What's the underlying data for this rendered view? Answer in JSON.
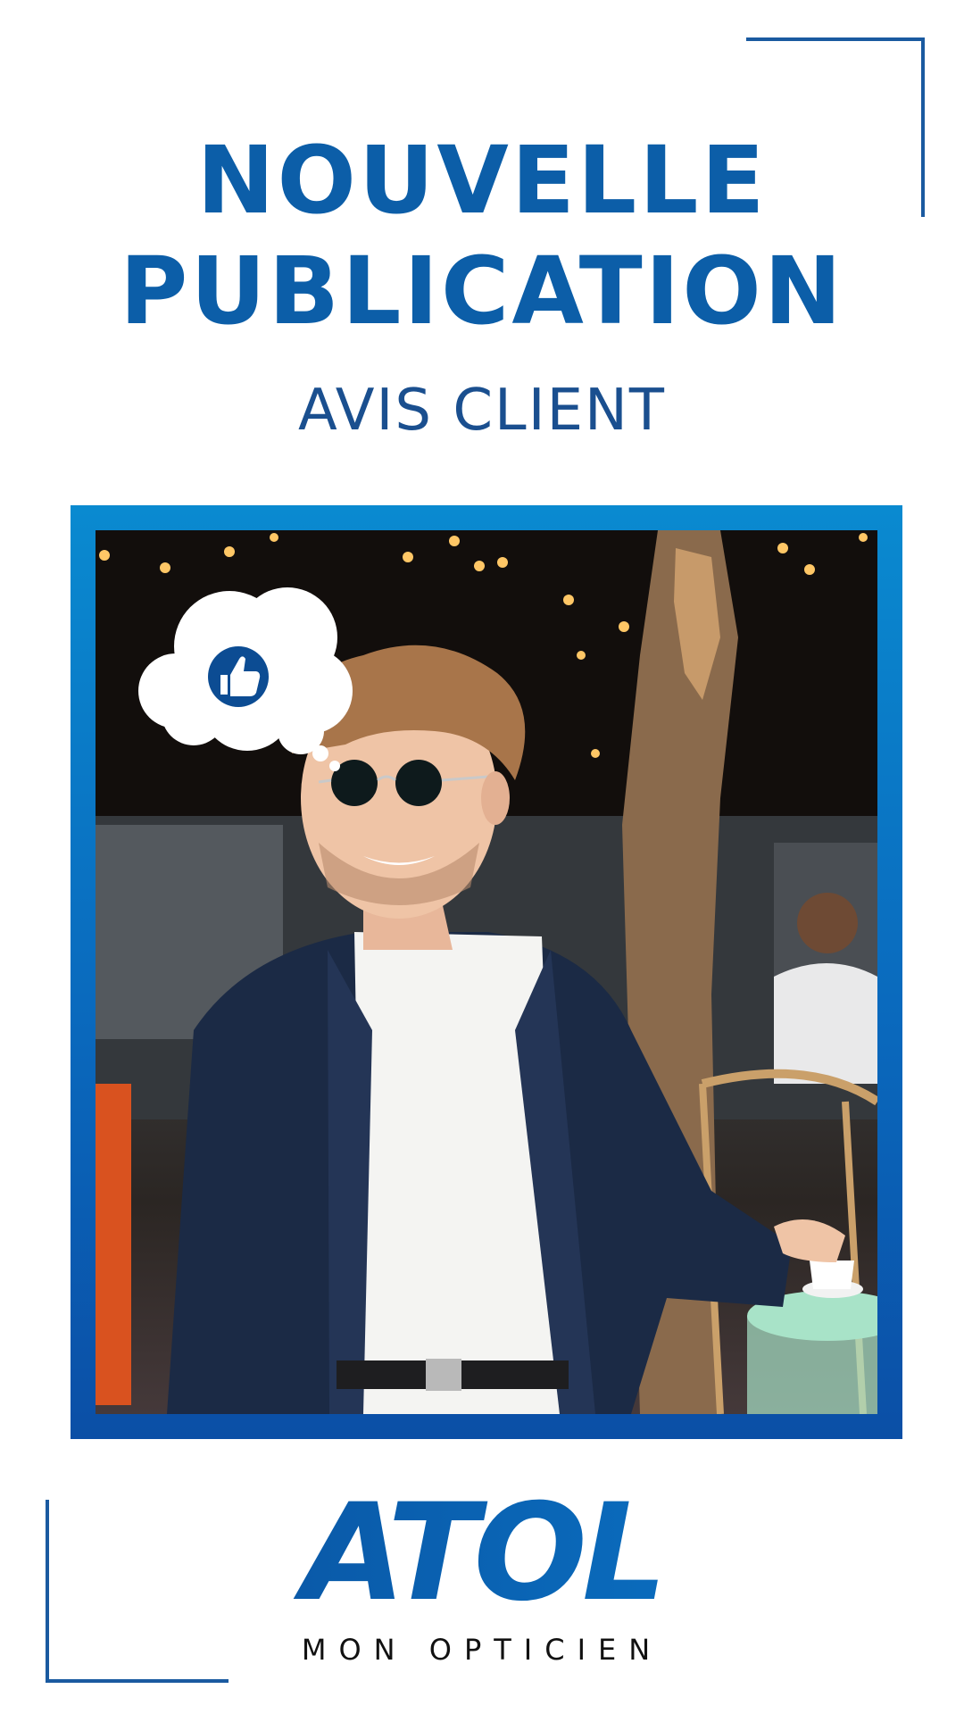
{
  "headline": {
    "line1": "NOUVELLE",
    "line2": "PUBLICATION"
  },
  "subtitle": "AVIS CLIENT",
  "photo": {
    "thought_bubble_icon": "thumbs-up-icon"
  },
  "logo": {
    "brand": "ATOL",
    "tagline": "MON OPTICIEN"
  },
  "colors": {
    "brand_blue": "#0c5ea8",
    "frame_top": "#0a8ad0",
    "frame_bottom": "#0b4fa6",
    "corner_lines": "#1a5aa0",
    "tagline": "#111111"
  }
}
